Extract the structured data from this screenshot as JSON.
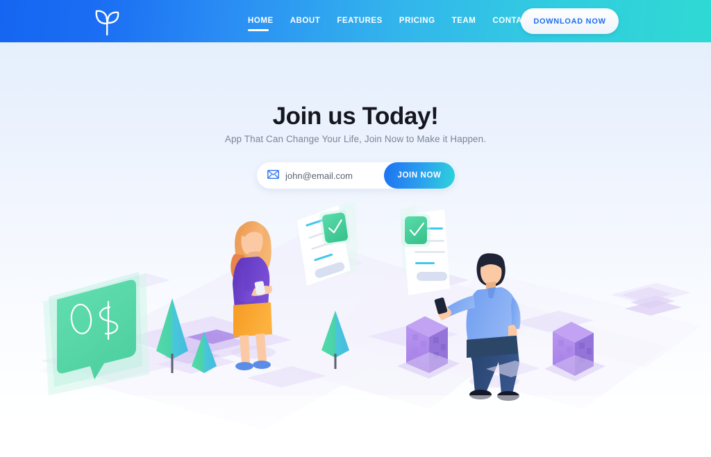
{
  "navbar": {
    "logo_name": "sprout-logo",
    "links": [
      {
        "label": "HOME",
        "active": true
      },
      {
        "label": "ABOUT",
        "active": false
      },
      {
        "label": "FEATURES",
        "active": false
      },
      {
        "label": "PRICING",
        "active": false
      },
      {
        "label": "TEAM",
        "active": false
      },
      {
        "label": "CONTACT",
        "active": false
      }
    ],
    "download_label": "DOWNLOAD NOW",
    "gradient_start": "#1565f2",
    "gradient_end": "#2fd9d3"
  },
  "hero": {
    "title": "Join us Today!",
    "subtitle": "App That Can Change Your Life, Join Now to Make it Happen.",
    "title_color": "#16161f",
    "subtitle_color": "#7c8599"
  },
  "signup": {
    "mail_icon": "envelope-icon",
    "email_value": "",
    "email_placeholder": "john@email.com",
    "submit_label": "JOIN NOW",
    "submit_gradient_start": "#1b72f2",
    "submit_gradient_end": "#2ed3dc"
  },
  "illustration": {
    "speech_bubble_text": "0$",
    "speech_bubble_color": "#57d8ab",
    "document_check_color": "#4fd2a0",
    "building_color": "#a982ec",
    "tree_left_color": "#4ed6a5",
    "tree_right_color": "#47c2e0",
    "ground_tile_color": "#d9cdf4",
    "woman": {
      "hair_color": "#f0a35e",
      "top_color": "#6b3fc9",
      "skirt_color": "#f6a42c",
      "shoe_color": "#5b8ce8"
    },
    "man": {
      "hair_color": "#1e2336",
      "shirt_color": "#7fa8f0",
      "pants_color": "#2c4668",
      "shoe_color": "#14182a",
      "phone_color": "#1c2438"
    }
  },
  "background": {
    "top_color": "#e3edfc",
    "bottom_color": "#ffffff"
  }
}
